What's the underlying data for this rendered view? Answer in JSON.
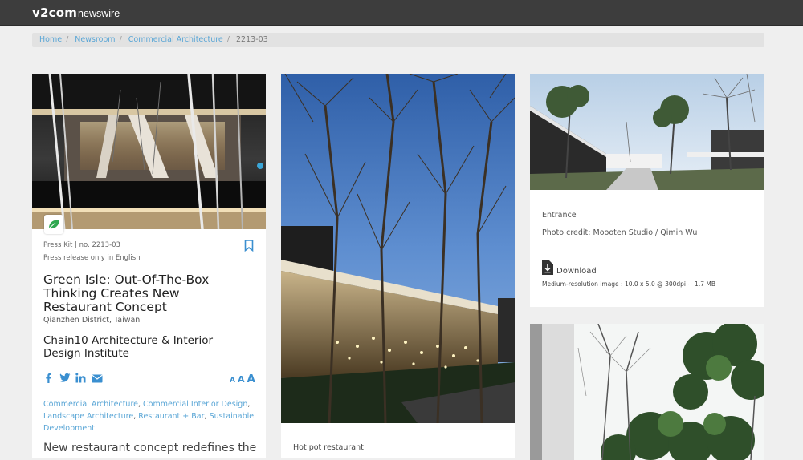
{
  "header": {
    "brand": "v2com",
    "sub": "newswire"
  },
  "breadcrumb": {
    "items": [
      "Home",
      "Newsroom",
      "Commercial Architecture"
    ],
    "current": "2213-03"
  },
  "article": {
    "press_kit": "Press Kit | no. 2213-03",
    "language_note": "Press release only in English",
    "title": "Green Isle: Out-Of-The-Box Thinking Creates New Restaurant Concept",
    "location": "Qianzhen District, Taiwan",
    "firm": "Chain10 Architecture & Interior Design Institute",
    "text_size_glyphs": [
      "A",
      "A",
      "A"
    ],
    "tags": [
      "Commercial Architecture",
      "Commercial Interior Design",
      "Landscape Architecture",
      "Restaurant + Bar",
      "Sustainable Development"
    ],
    "lede": "New restaurant concept redefines the"
  },
  "middle": {
    "caption": "Hot pot restaurant"
  },
  "right_top": {
    "caption": "Entrance",
    "credit": "Photo credit: Moooten Studio / Qimin Wu",
    "download_label": "Download",
    "download_info": "Medium-resolution image : 10.0 x 5.0 @ 300dpi ~ 1.7 MB"
  },
  "icons": {
    "leaf": "leaf-icon",
    "bookmark": "bookmark-icon",
    "social": [
      "facebook-icon",
      "twitter-icon",
      "linkedin-icon",
      "email-icon"
    ],
    "download": "download-icon"
  },
  "colors": {
    "topbar": "#3d3d3d",
    "link": "#5aa6d6",
    "accent": "#3a8fd0",
    "leaf": "#2fa84f"
  }
}
